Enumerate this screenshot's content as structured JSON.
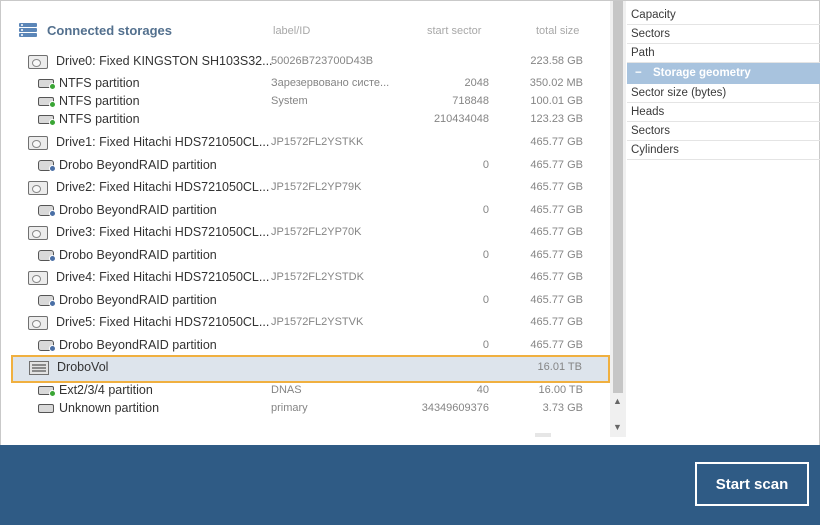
{
  "header": {
    "title": "Connected storages",
    "col_label": "label/ID",
    "col_sector": "start sector",
    "col_size": "total size"
  },
  "rows": [
    {
      "kind": "disk",
      "indent": 0,
      "name": "Drive0: Fixed KINGSTON SH103S32...",
      "label": "50026B723700D43B",
      "sector": "",
      "size": "223.58 GB"
    },
    {
      "kind": "part",
      "indent": 1,
      "name": "NTFS partition",
      "label": "Зарезервовано систе...",
      "sector": "2048",
      "size": "350.02 MB"
    },
    {
      "kind": "part",
      "indent": 1,
      "name": "NTFS partition",
      "label": "System",
      "sector": "718848",
      "size": "100.01 GB"
    },
    {
      "kind": "part",
      "indent": 1,
      "name": "NTFS partition",
      "label": "",
      "sector": "210434048",
      "size": "123.23 GB"
    },
    {
      "kind": "disk",
      "indent": 0,
      "name": "Drive1: Fixed Hitachi HDS721050CL...",
      "label": "JP1572FL2YSTKK",
      "sector": "",
      "size": "465.77 GB"
    },
    {
      "kind": "raidp",
      "indent": 1,
      "name": "Drobo BeyondRAID partition",
      "label": "",
      "sector": "0",
      "size": "465.77 GB"
    },
    {
      "kind": "disk",
      "indent": 0,
      "name": "Drive2: Fixed Hitachi HDS721050CL...",
      "label": "JP1572FL2YP79K",
      "sector": "",
      "size": "465.77 GB"
    },
    {
      "kind": "raidp",
      "indent": 1,
      "name": "Drobo BeyondRAID partition",
      "label": "",
      "sector": "0",
      "size": "465.77 GB"
    },
    {
      "kind": "disk",
      "indent": 0,
      "name": "Drive3: Fixed Hitachi HDS721050CL...",
      "label": "JP1572FL2YP70K",
      "sector": "",
      "size": "465.77 GB"
    },
    {
      "kind": "raidp",
      "indent": 1,
      "name": "Drobo BeyondRAID partition",
      "label": "",
      "sector": "0",
      "size": "465.77 GB"
    },
    {
      "kind": "disk",
      "indent": 0,
      "name": "Drive4: Fixed Hitachi HDS721050CL...",
      "label": "JP1572FL2YSTDK",
      "sector": "",
      "size": "465.77 GB"
    },
    {
      "kind": "raidp",
      "indent": 1,
      "name": "Drobo BeyondRAID partition",
      "label": "",
      "sector": "0",
      "size": "465.77 GB"
    },
    {
      "kind": "disk",
      "indent": 0,
      "name": "Drive5: Fixed Hitachi HDS721050CL...",
      "label": "JP1572FL2YSTVK",
      "sector": "",
      "size": "465.77 GB"
    },
    {
      "kind": "raidp",
      "indent": 1,
      "name": "Drobo BeyondRAID partition",
      "label": "",
      "sector": "0",
      "size": "465.77 GB"
    },
    {
      "kind": "raid",
      "indent": 0,
      "name": "DroboVol",
      "label": "",
      "sector": "",
      "size": "16.01 TB",
      "selected": true
    },
    {
      "kind": "part",
      "indent": 1,
      "name": "Ext2/3/4 partition",
      "label": "DNAS",
      "sector": "40",
      "size": "16.00 TB"
    },
    {
      "kind": "partgray",
      "indent": 1,
      "name": "Unknown partition",
      "label": "primary",
      "sector": "34349609376",
      "size": "3.73 GB"
    }
  ],
  "properties": {
    "items_top": [
      "Capacity",
      "Sectors",
      "Path"
    ],
    "group_label": "Storage geometry",
    "group_toggle": "−",
    "items_group": [
      "Sector size (bytes)",
      "Heads",
      "Sectors",
      "Cylinders"
    ]
  },
  "scrollbar": {
    "up": "▲",
    "down": "▼"
  },
  "bottom": {
    "scan_label": "Start scan"
  },
  "colors": {
    "accent": "#2f5b85",
    "selection_outline": "#f0b040",
    "group_header": "#a8c3de"
  }
}
